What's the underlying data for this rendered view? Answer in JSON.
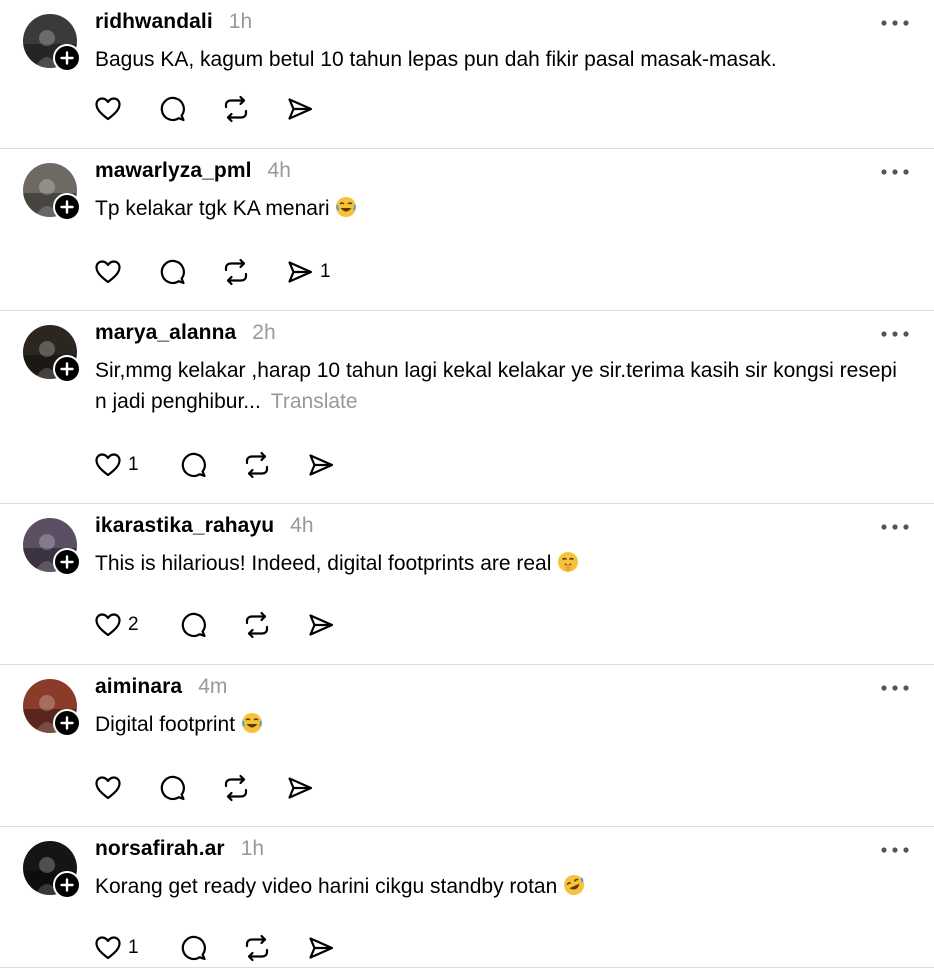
{
  "posts": [
    {
      "username": "ridhwandali",
      "time": "1h",
      "text": "Bagus KA, kagum betul 10 tahun lepas pun dah fikir pasal masak-masak.",
      "translate": "",
      "like_count": "",
      "share_count": "",
      "avatar_icon": "person-night-avatar",
      "avatar_color": "#3a3a3a"
    },
    {
      "username": "mawarlyza_pml",
      "time": "4h",
      "text": "Tp kelakar tgk KA menari",
      "emoji": "joy",
      "translate": "",
      "like_count": "",
      "share_count": "1",
      "avatar_icon": "house-photo-avatar",
      "avatar_color": "#6e6a63"
    },
    {
      "username": "marya_alanna",
      "time": "2h",
      "text": "Sir,mmg kelakar ,harap 10 tahun lagi kekal kelakar ye sir.terima kasih sir kongsi resepi n jadi penghibur...",
      "translate": "Translate",
      "like_count": "1",
      "share_count": "",
      "avatar_icon": "sunset-silhouette-avatar",
      "avatar_color": "#2b2620"
    },
    {
      "username": "ikarastika_rahayu",
      "time": "4h",
      "text": "This is hilarious! Indeed, digital footprints are real",
      "emoji": "giggle",
      "translate": "",
      "like_count": "2",
      "share_count": "",
      "avatar_icon": "tree-blossom-avatar",
      "avatar_color": "#5b4f63"
    },
    {
      "username": "aiminara",
      "time": "4m",
      "text": "Digital footprint",
      "emoji": "joy",
      "translate": "",
      "like_count": "",
      "share_count": "",
      "avatar_icon": "sunset-selfie-avatar",
      "avatar_color": "#8a3b2a"
    },
    {
      "username": "norsafirah.ar",
      "time": "1h",
      "text": "Korang get ready video harini cikgu standby rotan",
      "emoji": "rofl",
      "translate": "",
      "like_count": "1",
      "share_count": "",
      "avatar_icon": "dark-figure-avatar",
      "avatar_color": "#151515"
    }
  ],
  "colors": {
    "text": "#000000",
    "muted": "#999999",
    "divider": "#dcdcdc",
    "emoji": "#f7c23b"
  }
}
